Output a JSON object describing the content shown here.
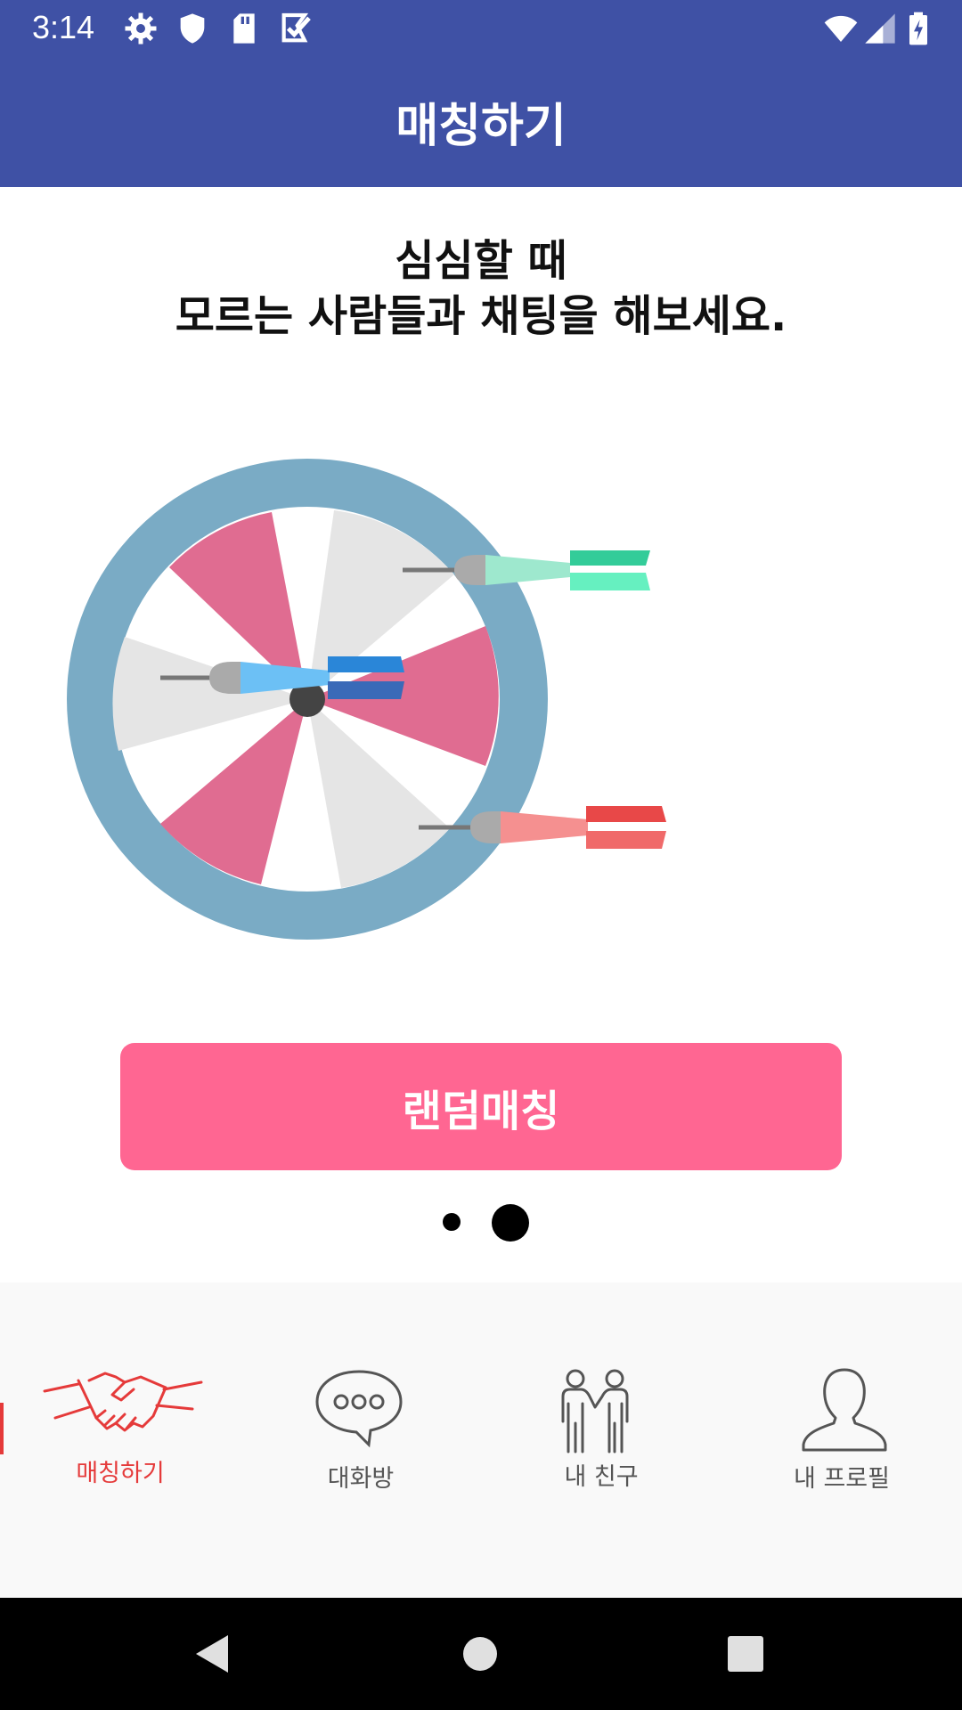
{
  "status_bar": {
    "time": "3:14",
    "icons": [
      "settings-icon",
      "shield-icon",
      "sd-card-icon",
      "checkmark-icon",
      "wifi-icon",
      "signal-icon",
      "battery-icon"
    ]
  },
  "app_bar": {
    "title": "매칭하기"
  },
  "headline": {
    "line1": "심심할 때",
    "line2": "모르는 사람들과 채팅을 해보세요."
  },
  "illustration": "dartboard-with-darts",
  "primary_button": {
    "label": "랜덤매칭",
    "color": "#ff6692"
  },
  "page_indicator": {
    "count": 2,
    "active_index": 1
  },
  "bottom_nav": {
    "active_index": 0,
    "items": [
      {
        "label": "매칭하기",
        "icon": "handshake-icon"
      },
      {
        "label": "대화방",
        "icon": "chat-bubble-icon"
      },
      {
        "label": "내 친구",
        "icon": "friends-icon"
      },
      {
        "label": "내 프로필",
        "icon": "profile-icon"
      }
    ]
  },
  "colors": {
    "primary": "#3f51a5",
    "accent": "#ff6692",
    "nav_active": "#e53a3a"
  }
}
